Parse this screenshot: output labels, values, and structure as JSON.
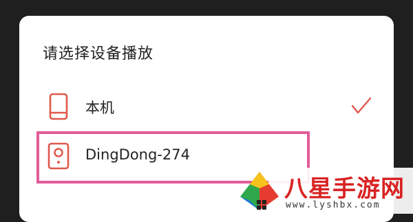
{
  "dialog": {
    "title": "请选择设备播放",
    "options": [
      {
        "label": "本机",
        "icon": "phone-icon",
        "selected": true
      },
      {
        "label": "DingDong-274",
        "icon": "speaker-icon",
        "selected": false
      }
    ]
  },
  "colors": {
    "accent": "#e0584b",
    "highlight": "#e25b97",
    "watermark_text": "#d92323"
  },
  "watermark": {
    "name": "八星手游网",
    "url": "www.lyshbx.com"
  }
}
